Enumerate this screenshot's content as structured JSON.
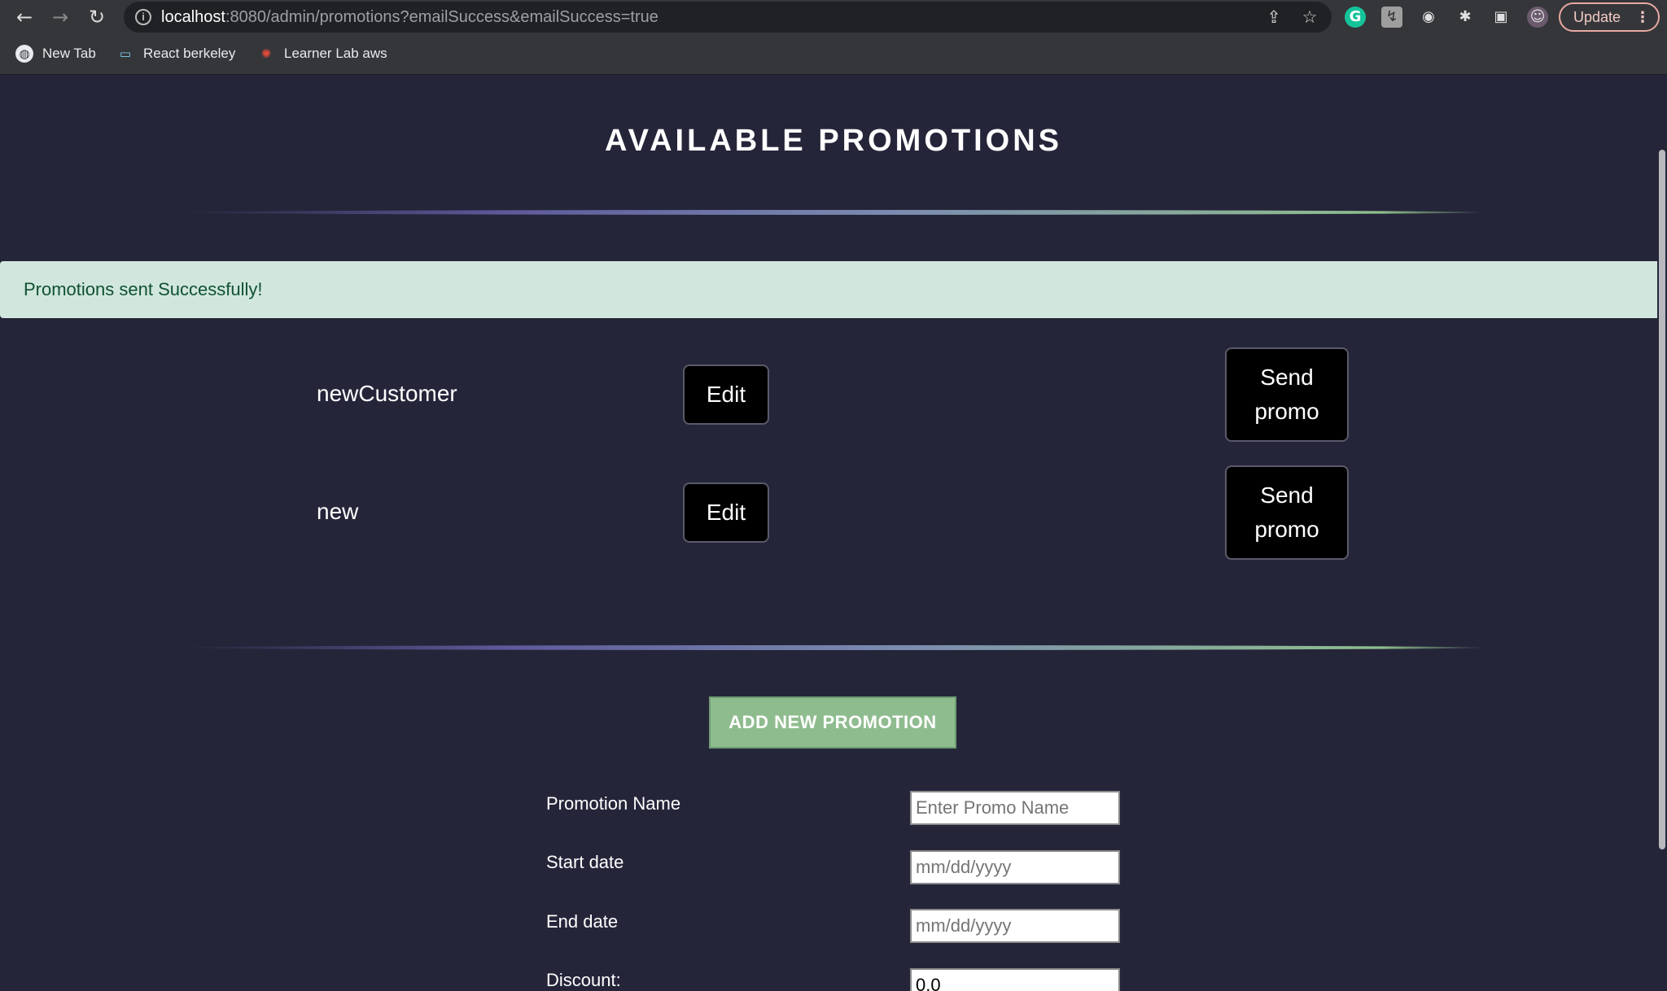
{
  "browser": {
    "url_host": "localhost",
    "url_path": ":8080/admin/promotions?emailSuccess&emailSuccess=true",
    "update_label": "Update",
    "bookmarks": [
      {
        "label": "New Tab",
        "icon": "globe-icon"
      },
      {
        "label": "React berkeley",
        "icon": "monitor-icon"
      },
      {
        "label": "Learner Lab aws",
        "icon": "aws-logo-icon"
      }
    ]
  },
  "page": {
    "title": "AVAILABLE PROMOTIONS",
    "alert": "Promotions sent Successfully!",
    "promotions": [
      {
        "name": "newCustomer",
        "edit_label": "Edit",
        "send_label_1": "Send",
        "send_label_2": "promo"
      },
      {
        "name": "new",
        "edit_label": "Edit",
        "send_label_1": "Send",
        "send_label_2": "promo"
      }
    ],
    "add_button": "ADD NEW PROMOTION",
    "form": {
      "name_label": "Promotion Name",
      "name_placeholder": "Enter Promo Name",
      "start_label": "Start date",
      "start_placeholder": "mm/dd/yyyy",
      "end_label": "End date",
      "end_placeholder": "mm/dd/yyyy",
      "discount_label": "Discount:",
      "discount_value": "0.0"
    }
  },
  "colors": {
    "background": "#25253a",
    "alert_bg": "#d1e7dd",
    "alert_text": "#0f5132",
    "add_button_bg": "#8fbc8f"
  }
}
